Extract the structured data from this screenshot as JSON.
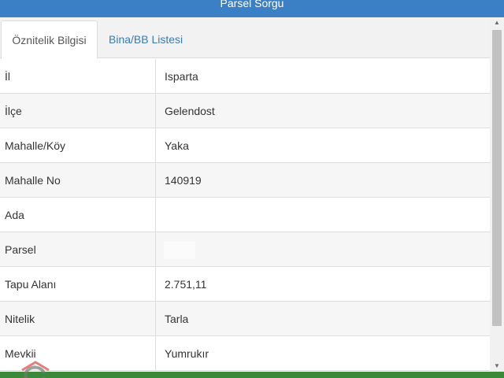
{
  "header": {
    "title": "Parsel Sorgu"
  },
  "tabs": [
    {
      "label": "Öznitelik Bilgisi",
      "active": true
    },
    {
      "label": "Bina/BB Listesi",
      "active": false
    }
  ],
  "rows": [
    {
      "key": "İl",
      "value": "Isparta"
    },
    {
      "key": "İlçe",
      "value": "Gelendost"
    },
    {
      "key": "Mahalle/Köy",
      "value": "Yaka"
    },
    {
      "key": "Mahalle No",
      "value": "140919"
    },
    {
      "key": "Ada",
      "value": ""
    },
    {
      "key": "Parsel",
      "value": ""
    },
    {
      "key": "Tapu Alanı",
      "value": "2.751,11"
    },
    {
      "key": "Nitelik",
      "value": "Tarla"
    },
    {
      "key": "Mevkii",
      "value": "Yumrukır"
    }
  ],
  "scrollbar": {
    "up_glyph": "▲",
    "down_glyph": "▼"
  },
  "colors": {
    "header": "#3b7fc4",
    "link": "#3a7ab8",
    "footer": "#3a8a3a"
  },
  "icons": {
    "logo": "watermark-logo-icon"
  }
}
